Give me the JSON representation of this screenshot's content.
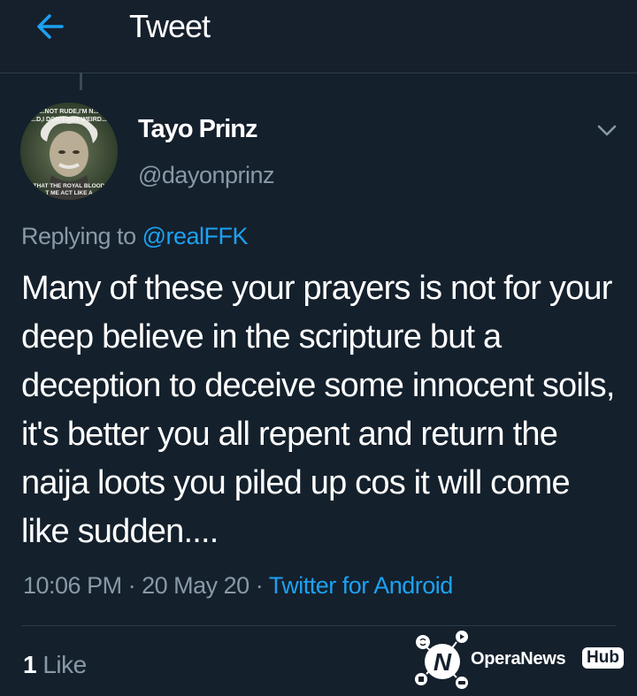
{
  "header": {
    "title": "Tweet",
    "back_icon": "arrow-left-icon",
    "accent": "#1da1f2"
  },
  "author": {
    "display_name": "Tayo Prinz",
    "handle": "@dayonprinz",
    "avatar_icon": "avatar-meme-image",
    "avatar_text_top": [
      "...NOT RUDE,I'M N...",
      "...D,I DON'T ACT WEIRD..."
    ],
    "avatar_text_bottom": [
      "...THAT THE ROYAL BLOOD...",
      "...T ME ACT LIKE A..."
    ]
  },
  "tweet": {
    "replying_prefix": "Replying to",
    "replying_to": "@realFFK",
    "text": "Many of these your prayers is not for your deep believe in the scripture but a deception to deceive some innocent soils, it's better you all repent and return the naija loots you piled up cos it will come like sudden....",
    "time": "10:06 PM",
    "date": "20 May 20",
    "source": "Twitter for Android",
    "separator": "·"
  },
  "stats": {
    "like_count": "1",
    "like_label": "Like"
  },
  "watermark": {
    "brand": "OperaNews",
    "hub": "Hub",
    "logo_icon": "opera-news-logo-icon"
  },
  "colors": {
    "background": "#14202c",
    "secondary_text": "#8899a6",
    "link": "#1da1f2",
    "divider": "#2d3b48"
  }
}
